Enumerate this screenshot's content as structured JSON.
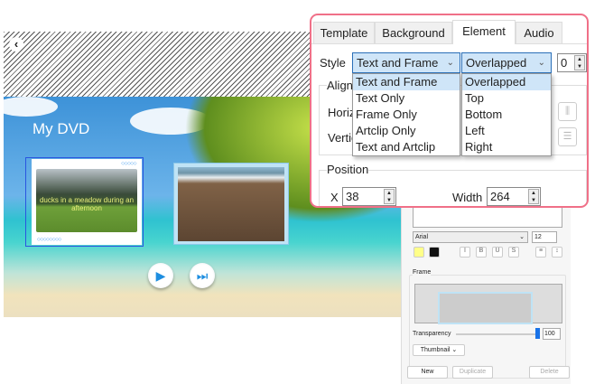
{
  "preview": {
    "title": "My DVD",
    "caption": "ducks in a meadow during an afternoon",
    "back_icon": "chevron-left-icon",
    "play_icon": "play-icon",
    "next_icon": "skip-next-icon"
  },
  "panel": {
    "font": "Arial",
    "font_size": "12",
    "frame_label": "Frame",
    "transparency_label": "Transparency",
    "transparency": "100",
    "thumbnail_label": "Thumbnail",
    "new": "New",
    "duplicate": "Duplicate",
    "delete": "Delete",
    "color_swatch": "#ffff88"
  },
  "popup": {
    "tabs": [
      "Template",
      "Background",
      "Element",
      "Audio"
    ],
    "active_tab": "Element",
    "style_label": "Style",
    "style_value": "Text and Frame",
    "style_options": [
      "Text and Frame",
      "Text Only",
      "Frame Only",
      "Artclip Only",
      "Text and Artclip"
    ],
    "layout_value": "Overlapped",
    "layout_options": [
      "Overlapped",
      "Top",
      "Bottom",
      "Left",
      "Right"
    ],
    "spacing": "0",
    "align_label": "Align",
    "horizontal_label": "Horiz",
    "vertical_label": "Vertic",
    "position_label": "Position",
    "x_label": "X",
    "x_value": "38",
    "width_label": "Width",
    "width_value": "264",
    "border_color": "#f07088"
  }
}
